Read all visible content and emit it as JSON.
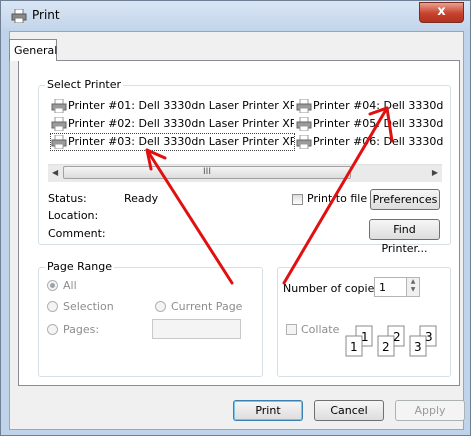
{
  "window": {
    "title": "Print",
    "close_label": "x"
  },
  "tabs": [
    {
      "label": "General"
    }
  ],
  "select_printer": {
    "group_label": "Select Printer",
    "printers": [
      {
        "label": "Printer #01: Dell 3330dn Laser Printer XPS"
      },
      {
        "label": "Printer #02: Dell 3330dn Laser Printer XPS"
      },
      {
        "label": "Printer #03: Dell 3330dn Laser Printer XPS"
      },
      {
        "label": "Printer #04: Dell 3330dn L"
      },
      {
        "label": "Printer #05: Dell 3330dn L"
      },
      {
        "label": "Printer #06: Dell 3330dn L"
      }
    ],
    "scroll_left": "◀",
    "scroll_right": "▶",
    "scroll_grip": "III",
    "status_label": "Status:",
    "status_value": "Ready",
    "location_label": "Location:",
    "comment_label": "Comment:",
    "print_to_file": "Print to file",
    "preferences": "Preferences",
    "find_printer": "Find Printer..."
  },
  "page_range": {
    "group_label": "Page Range",
    "all": "All",
    "selection": "Selection",
    "current_page": "Current Page",
    "pages": "Pages:"
  },
  "copies": {
    "number_label": "Number of copies:",
    "value": "1",
    "collate": "Collate",
    "collate_pages": [
      "1",
      "1",
      "2",
      "2",
      "3",
      "3"
    ]
  },
  "buttons": {
    "print": "Print",
    "cancel": "Cancel",
    "apply": "Apply"
  },
  "colors": {
    "annotation_arrows": "#e01010",
    "accent": "#3c7fb1"
  }
}
